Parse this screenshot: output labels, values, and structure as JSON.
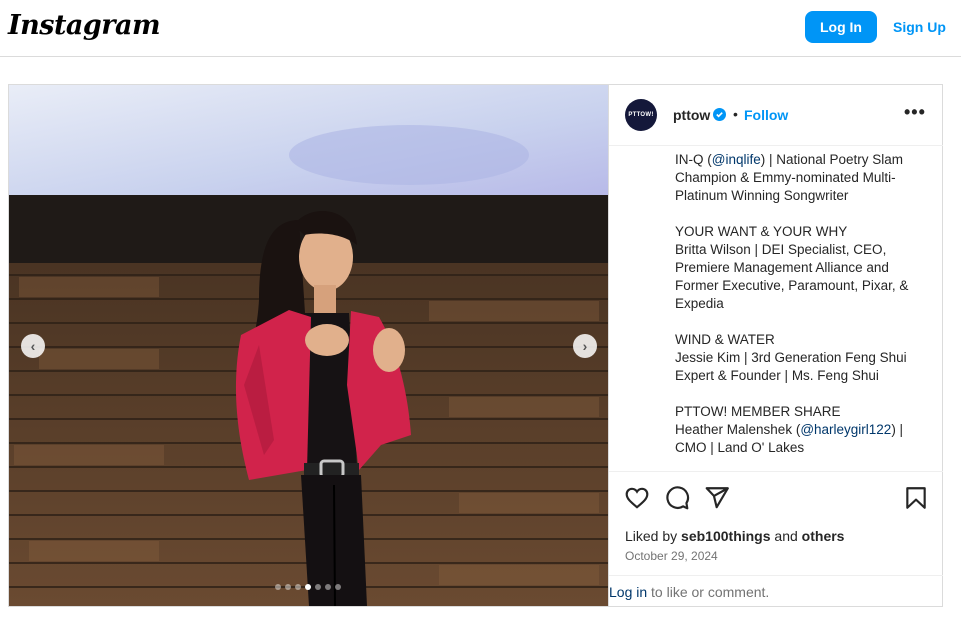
{
  "header": {
    "logo_text": "Instagram",
    "login_label": "Log In",
    "signup_label": "Sign Up"
  },
  "media": {
    "prev_icon": "chevron-left-icon",
    "next_icon": "chevron-right-icon",
    "carousel_count": 7,
    "carousel_active_index": 3
  },
  "post": {
    "avatar_text": "PTTOW!",
    "username": "pttow",
    "separator": "•",
    "follow_label": "Follow",
    "more_label": "•••",
    "caption": {
      "b1_l1_pre": "IN-Q (",
      "b1_l1_link": "@inqlife",
      "b1_l1_post": ") | National Poetry Slam",
      "b1_l2": "Champion & Emmy-nominated Multi-",
      "b1_l3": "Platinum Winning Songwriter",
      "b2_l1": "YOUR WANT & YOUR WHY",
      "b2_l2": "Britta Wilson | DEI Specialist, CEO,",
      "b2_l3": "Premiere Management Alliance and",
      "b2_l4": "Former Executive, Paramount, Pixar, &",
      "b2_l5": "Expedia",
      "b3_l1": "WIND & WATER",
      "b3_l2": "Jessie Kim | 3rd Generation Feng Shui",
      "b3_l3": "Expert & Founder | Ms. Feng Shui",
      "b4_l1": "PTTOW! MEMBER SHARE",
      "b4_l2_pre": "Heather Malenshek (",
      "b4_l2_link": "@harleygirl122",
      "b4_l2_post": ") |",
      "b4_l3": "CMO | Land O' Lakes"
    },
    "liked_prefix": "Liked by ",
    "liked_user": "seb100things",
    "liked_and": " and ",
    "liked_others": "others",
    "date": "October 29, 2024",
    "login_link": "Log in",
    "comment_suffix": " to like or comment."
  },
  "colors": {
    "accent": "#0095f6",
    "link": "#00376b",
    "blazer": "#d1234b"
  }
}
